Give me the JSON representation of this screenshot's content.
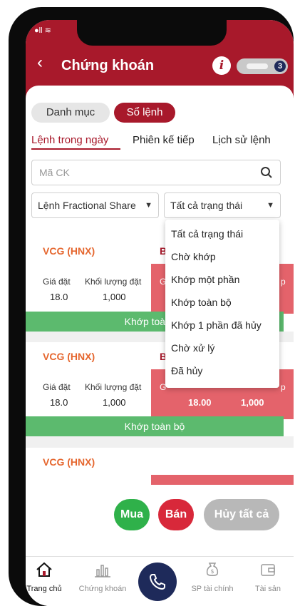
{
  "header": {
    "title": "Chứng khoán",
    "badge_count": "3"
  },
  "segments": {
    "portfolio": "Danh mục",
    "order_book": "Sổ lệnh"
  },
  "tabs": [
    "Lệnh trong ngày",
    "Phiên kế tiếp",
    "Lịch sử lệnh"
  ],
  "search": {
    "placeholder": "Mã CK"
  },
  "filters": {
    "order_type": "Lệnh Fractional Share",
    "status": "Tất cả trạng thái"
  },
  "status_options": [
    "Tất cả trạng thái",
    "Chờ khớp",
    "Khớp một phần",
    "Khớp toàn bộ",
    "Khớp 1 phần đã hủy",
    "Chờ xử lý",
    "Đã hủy"
  ],
  "orders": [
    {
      "symbol": "VCG (HNX)",
      "side": "B",
      "price_label": "Giá đặt",
      "qty_label": "Khối lượng đặt",
      "price": "18.0",
      "qty": "1,000",
      "match_label_left": "G",
      "match_label_right": "p",
      "match_price": "",
      "match_qty": "",
      "status": "Khớp toàn bộ"
    },
    {
      "symbol": "VCG (HNX)",
      "side": "B",
      "price_label": "Giá đặt",
      "qty_label": "Khối lượng đặt",
      "price": "18.0",
      "qty": "1,000",
      "match_label_left": "G",
      "match_label_right": "p",
      "match_price": "18.00",
      "match_qty": "1,000",
      "status": "Khớp toàn bộ"
    },
    {
      "symbol": "VCG (HNX)"
    }
  ],
  "actions": {
    "buy": "Mua",
    "sell": "Bán",
    "cancel_all": "Hủy tất cả"
  },
  "bottom_nav": {
    "home": "Trang chủ",
    "stocks": "Chứng khoán",
    "financial_products": "SP tài chính",
    "assets": "Tài sản"
  },
  "colors": {
    "brand": "#a8192b",
    "buy": "#2fb14a",
    "sell": "#d8283a",
    "navy": "#1e2a5a",
    "matched": "#5cba6e"
  }
}
